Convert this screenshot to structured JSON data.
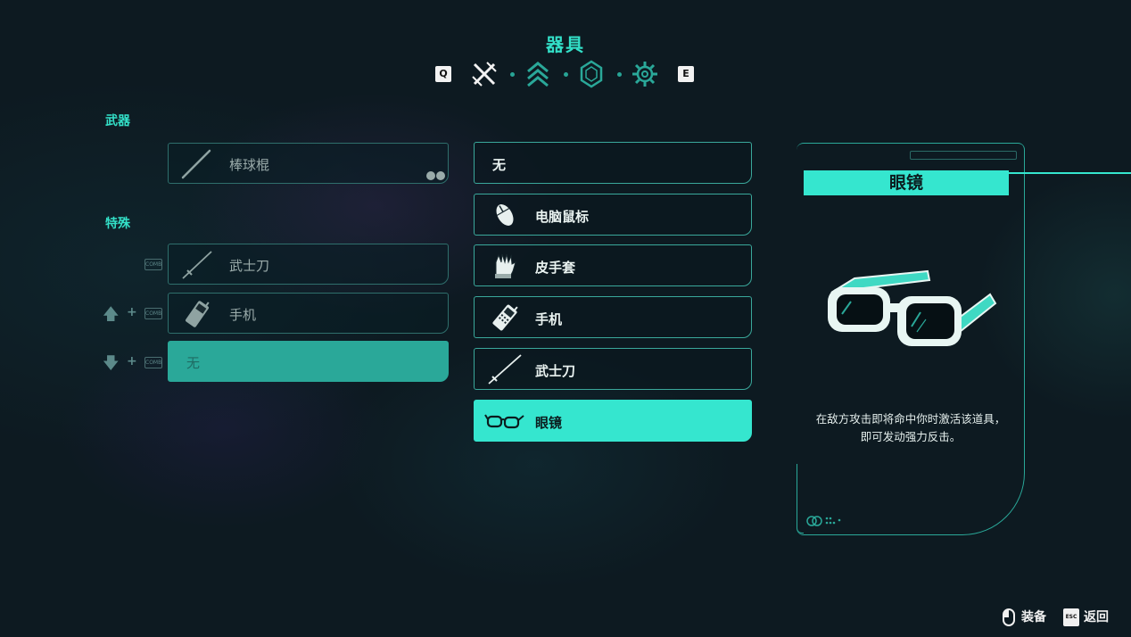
{
  "header": {
    "title": "器具",
    "prev_key": "Q",
    "next_key": "E",
    "tabs": [
      {
        "icon": "crossed-swords-icon",
        "active": true
      },
      {
        "icon": "rank-chevrons-icon",
        "active": false
      },
      {
        "icon": "gem-icon",
        "active": false
      },
      {
        "icon": "gear-icon",
        "active": false
      }
    ]
  },
  "loadout": {
    "weapons_label": "武器",
    "weapon_slot": {
      "label": "棒球棍",
      "icon": "bat-icon"
    },
    "special_label": "特殊",
    "special_slots": [
      {
        "label": "武士刀",
        "icon": "katana-icon",
        "key_hint": "COMB"
      },
      {
        "label": "手机",
        "icon": "phone-icon",
        "key_hint": "COMB",
        "direction": "up"
      },
      {
        "label": "无",
        "icon": "",
        "key_hint": "COMB",
        "direction": "down",
        "selected": true
      }
    ]
  },
  "items": [
    {
      "label": "无",
      "icon": ""
    },
    {
      "label": "电脑鼠标",
      "icon": "mouse-icon"
    },
    {
      "label": "皮手套",
      "icon": "glove-icon"
    },
    {
      "label": "手机",
      "icon": "phone-icon"
    },
    {
      "label": "武士刀",
      "icon": "katana-icon"
    },
    {
      "label": "眼镜",
      "icon": "glasses-icon",
      "active": true
    }
  ],
  "detail": {
    "title": "眼镜",
    "description": "在敌方攻击即将命中你时激活该道具，即可发动强力反击。",
    "art": "glasses-icon"
  },
  "footer": {
    "equip_label": "装备",
    "back_label": "返回",
    "back_key": "ESC"
  },
  "colors": {
    "accent": "#35e6cf",
    "background": "#0d1a21",
    "slot_border": "#2f6f6c"
  }
}
